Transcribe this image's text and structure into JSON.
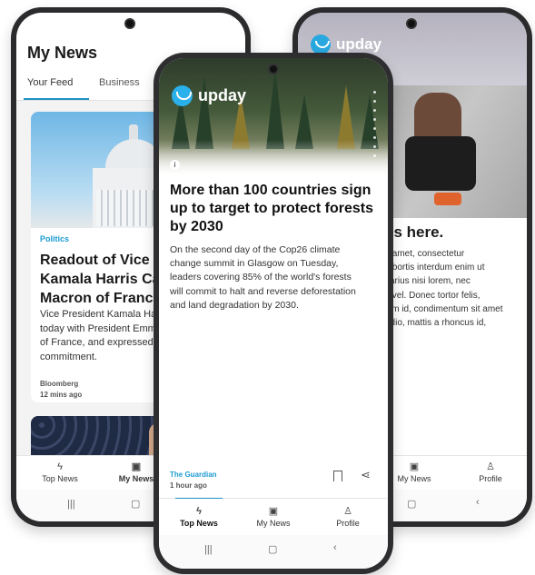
{
  "left_phone": {
    "title": "My News",
    "tabs": [
      "Your Feed",
      "Business"
    ],
    "card": {
      "category": "Politics",
      "headline": "Readout of Vice P\nKamala Harris Ca\nMacron of France",
      "text": "Vice President Kamala Ha\ntoday with President Emm\nof France, and expressed\ncommitment.",
      "source": "Bloomberg",
      "time": "12 mins ago"
    },
    "nav": [
      "Top News",
      "My News"
    ]
  },
  "center_phone": {
    "logo": "upday",
    "headline": "More than 100 countries sign\nup to target to protect forests\nby 2030",
    "text": "On the second day of the Cop26 climate\nchange summit in Glasgow on Tuesday,\nleaders covering 85% of the world's forests\nwill commit to halt and reverse deforestation\nand land degradation by 2030.",
    "source": "The Guardian",
    "time": "1 hour ago",
    "nav": [
      "Top News",
      "My News",
      "Profile"
    ]
  },
  "right_phone": {
    "logo": "upday",
    "title": "es here.",
    "text": "it amet, consectetur\nlobortis interdum enim ut\nvarius nisi lorem, nec\ns vel. Donec tortor felis,\nsim id, condimentum sit amet\nodio, mattis a rhoncus id,",
    "nav": [
      "My News",
      "Profile"
    ]
  },
  "colors": {
    "accent": "#1c93c4",
    "logo_blue": "#2ab0ea"
  }
}
